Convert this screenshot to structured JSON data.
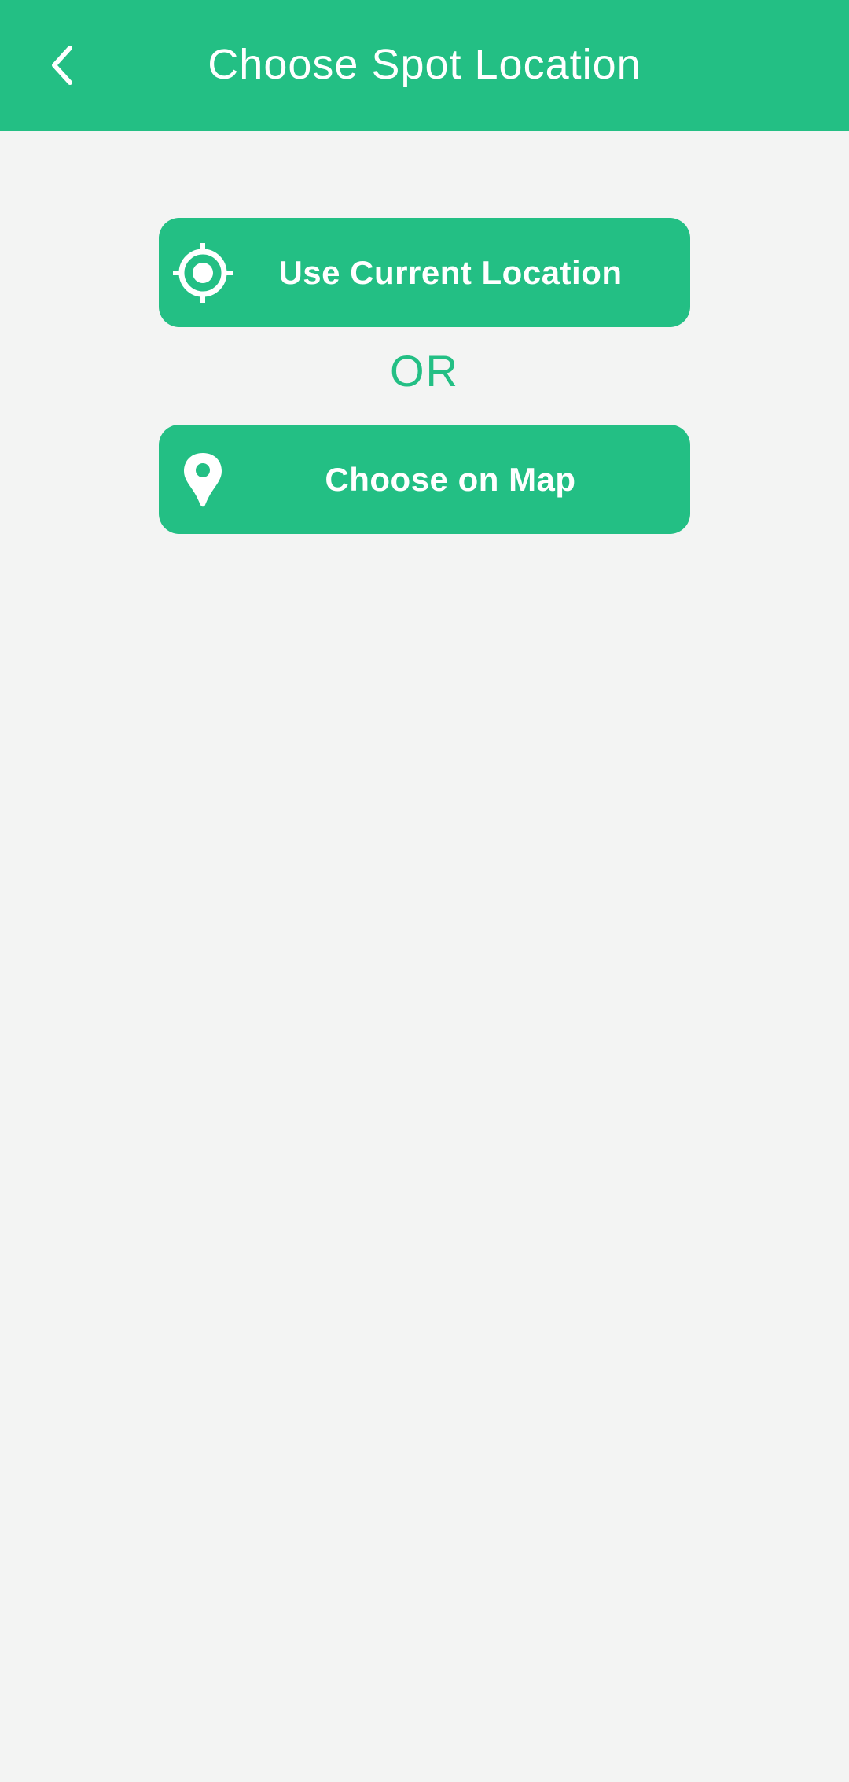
{
  "header": {
    "title": "Choose Spot Location",
    "back_icon": "chevron-left-icon"
  },
  "actions": {
    "current_location": {
      "label": "Use Current Location",
      "icon": "crosshair-target-icon"
    },
    "separator": "OR",
    "choose_on_map": {
      "label": "Choose on Map",
      "icon": "map-pin-icon"
    }
  },
  "colors": {
    "accent": "#23bf84",
    "background": "#f3f4f3",
    "on_accent": "#ffffff"
  }
}
